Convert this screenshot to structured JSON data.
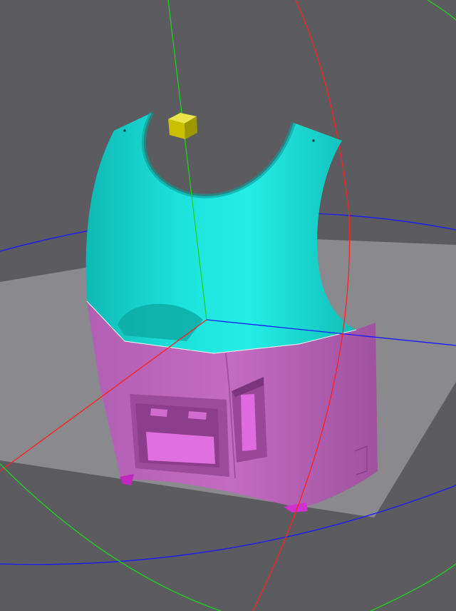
{
  "viewport": {
    "background": "#5b5b60",
    "build_plate_color": "#8e8d92",
    "model_upper_color": "#18d8d2",
    "model_lower_color": "#b75ab6",
    "gizmo": {
      "handle_color": "#c8c000",
      "x_axis_color": "#ff2020",
      "y_axis_color": "#20d020",
      "z_axis_color": "#1a1aff"
    }
  }
}
